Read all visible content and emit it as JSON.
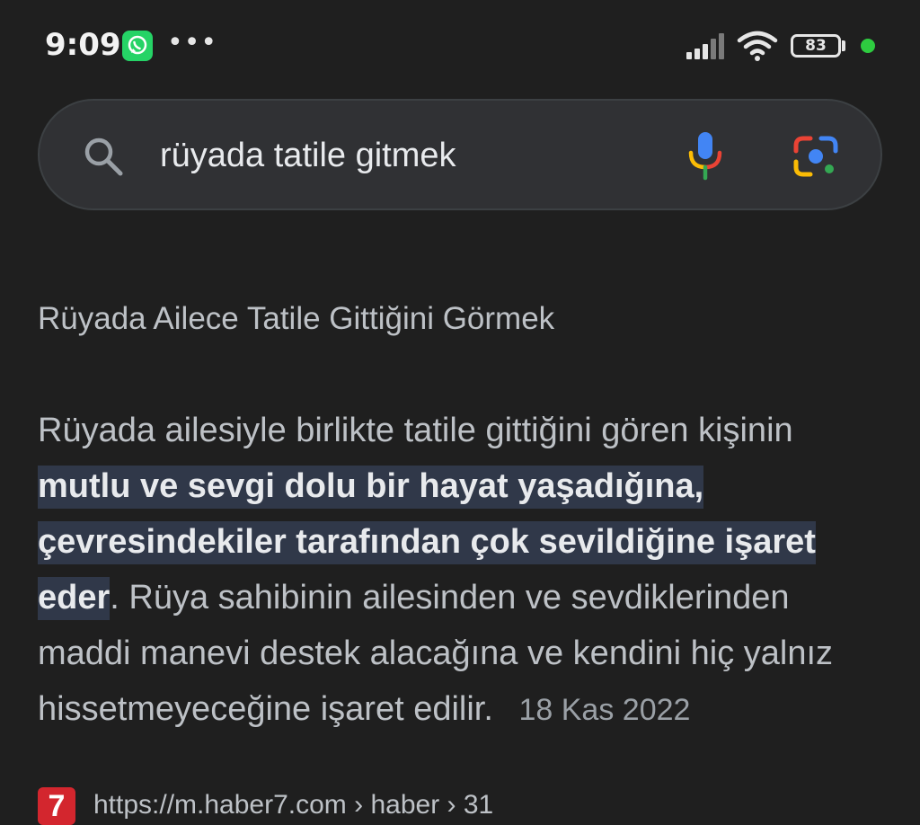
{
  "status_bar": {
    "time": "9:09",
    "notification_icons": [
      "whatsapp-icon",
      "more-dots-icon"
    ],
    "overflow_glyph": "•••",
    "battery_level": "83",
    "indicator_color": "#2ecc40"
  },
  "search": {
    "query": "rüyada tatile gitmek",
    "icons": [
      "search-icon",
      "mic-icon",
      "google-lens-icon"
    ]
  },
  "snippet": {
    "heading": "Rüyada Ailece Tatile Gittiğini Görmek",
    "text_before": "Rüyada ailesiyle birlikte tatile gittiğini gören kişinin",
    "highlight": "mutlu ve sevgi dolu bir hayat yaşadığına, çevresindekiler tarafından çok sevildiğine işaret eder",
    "text_after": ". Rüya sahibinin ailesinden ve sevdiklerinden maddi manevi destek alacağına ve kendini hiç yalnız hissetmeyeceğine işaret edilir.",
    "date": "18 Kas 2022",
    "highlight_color": "#303849"
  },
  "source": {
    "favicon_label": "7",
    "url": "https://m.haber7.com › haber › 31"
  }
}
